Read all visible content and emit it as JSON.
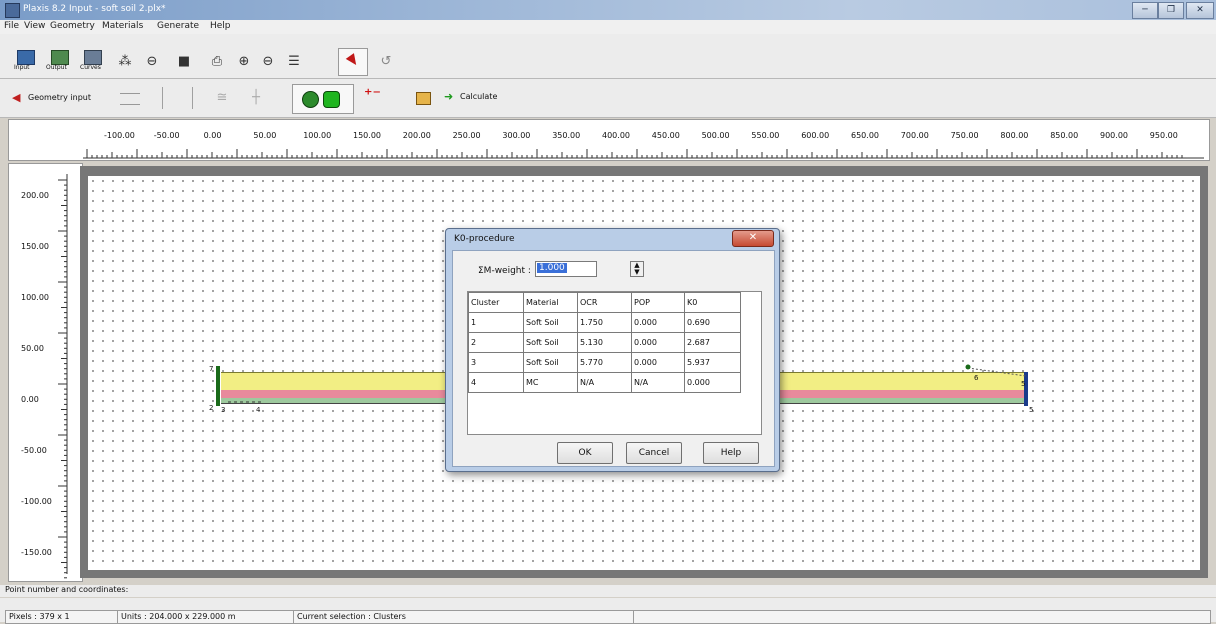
{
  "window": {
    "title": "Plaxis 8.2 Input - soft soil 2.plx*",
    "minimize_glyph": "─",
    "restore_glyph": "❐",
    "close_glyph": "✕"
  },
  "menu": [
    "File",
    "View",
    "Geometry",
    "Materials",
    "Generate",
    "Help"
  ],
  "toolbar1": {
    "input_label": "Input",
    "output_label": "Output",
    "curves_label": "Curves"
  },
  "toolbar2": {
    "geometry_input_label": "Geometry input",
    "calculate_label": "Calculate"
  },
  "ruler": {
    "x_ticks": [
      "-100.00",
      "-50.00",
      "0.00",
      "50.00",
      "100.00",
      "150.00",
      "200.00",
      "250.00",
      "300.00",
      "350.00",
      "400.00",
      "450.00",
      "500.00",
      "550.00",
      "600.00",
      "650.00",
      "700.00",
      "750.00",
      "800.00",
      "850.00",
      "900.00",
      "950.00"
    ],
    "y_ticks": [
      "200.00",
      "150.00",
      "100.00",
      "50.00",
      "0.00",
      "-50.00",
      "-100.00",
      "-150.00"
    ]
  },
  "geometry": {
    "point_labels": [
      "7",
      "6",
      "5",
      "2",
      "3",
      "4",
      "5"
    ],
    "layer_colors": [
      "#f2ee84",
      "#e88a9c",
      "#9ec99e"
    ]
  },
  "dialog": {
    "title": "K0-procedure",
    "mweight_label": "ΣM-weight :",
    "mweight_value": "1.000",
    "columns": [
      "Cluster",
      "Material",
      "OCR",
      "POP",
      "K0"
    ],
    "rows": [
      [
        "1",
        "Soft Soil",
        "1.750",
        "0.000",
        "0.690"
      ],
      [
        "2",
        "Soft Soil",
        "5.130",
        "0.000",
        "2.687"
      ],
      [
        "3",
        "Soft Soil",
        "5.770",
        "0.000",
        "5.937"
      ],
      [
        "4",
        "MC",
        "N/A",
        "N/A",
        "0.000"
      ]
    ],
    "ok_label": "OK",
    "cancel_label": "Cancel",
    "help_label": "Help"
  },
  "status": {
    "point_coordinate": "Point number and coordinates:",
    "pixels": "Pixels : 379 x 1",
    "units": "Units : 204.000 x 229.000 m",
    "selection": "Current selection : Clusters"
  }
}
